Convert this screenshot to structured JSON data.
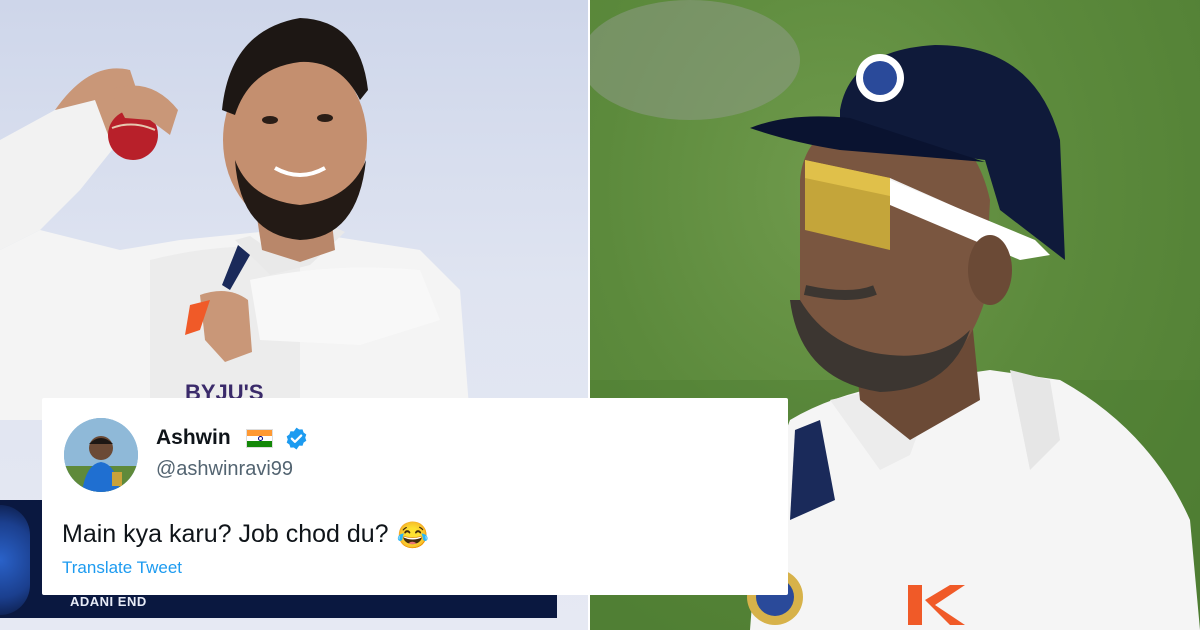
{
  "left_photo": {
    "subject": "Cricketer in white India test kit holding a red ball",
    "jersey_text": "BYJU'S",
    "accent": "#b8202a"
  },
  "right_photo": {
    "subject": "Cricketer in navy cap and sports sunglasses on the field",
    "accent": "#f05a28"
  },
  "scoreboard": {
    "end_label": "ADANI END"
  },
  "tweet": {
    "display_name": "Ashwin",
    "flag_icon": "india-flag-icon",
    "verified_icon": "verified-badge-icon",
    "handle": "@ashwinravi99",
    "text": "Main kya karu? Job chod du?",
    "emoji": "😂",
    "translate_label": "Translate Tweet",
    "colors": {
      "name": "#0f1419",
      "handle": "#536471",
      "link": "#1d9bf0",
      "verified": "#1d9bf0"
    }
  }
}
